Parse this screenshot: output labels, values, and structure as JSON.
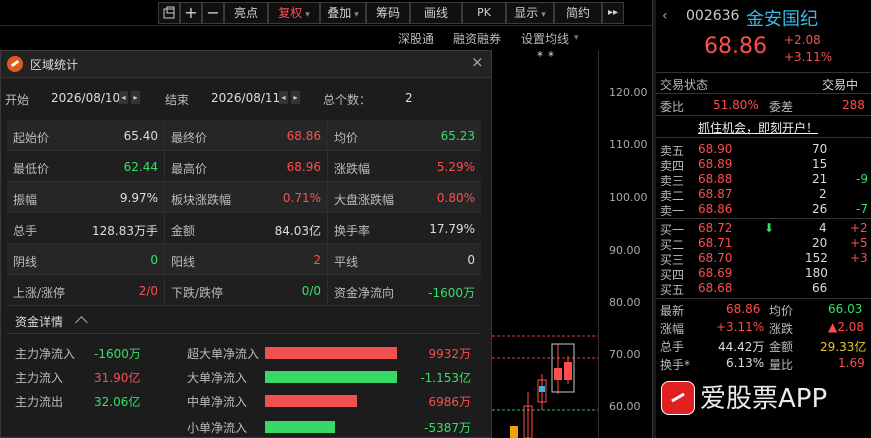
{
  "toolbar": {
    "icons": [
      "window-icon",
      "plus-icon",
      "minus-icon"
    ],
    "buttons": [
      {
        "label": "亮点",
        "active": false
      },
      {
        "label": "复权",
        "active": true,
        "caret": "▾"
      },
      {
        "label": "叠加",
        "active": false,
        "caret": "▾"
      },
      {
        "label": "筹码",
        "active": false
      },
      {
        "label": "画线",
        "active": false
      },
      {
        "label": "PK",
        "active": false
      },
      {
        "label": "显示",
        "active": false,
        "caret": "▾"
      },
      {
        "label": "简约",
        "active": false
      }
    ],
    "more": "▸▸",
    "subbar": {
      "sh_sz": "深股通",
      "margin": "融资融券",
      "ma": "设置均线",
      "ma_caret": "▾"
    }
  },
  "chart": {
    "stars": "**",
    "y_ticks": [
      "120.00",
      "110.00",
      "100.00",
      "90.00",
      "80.00",
      "70.00",
      "60.00"
    ]
  },
  "dialog": {
    "title": "区域统计",
    "close": "×",
    "start_label": "开始",
    "start_value": "2026/08/10",
    "end_label": "结束",
    "end_value": "2026/08/11",
    "count_label": "总个数：",
    "count_value": "2",
    "stats": [
      [
        {
          "l": "起始价",
          "v": "65.40",
          "c": "white"
        },
        {
          "l": "最终价",
          "v": "68.86",
          "c": "red"
        },
        {
          "l": "均价",
          "v": "65.23",
          "c": "green"
        }
      ],
      [
        {
          "l": "最低价",
          "v": "62.44",
          "c": "green"
        },
        {
          "l": "最高价",
          "v": "68.96",
          "c": "red"
        },
        {
          "l": "涨跌幅",
          "v": "5.29%",
          "c": "red"
        }
      ],
      [
        {
          "l": "振幅",
          "v": "9.97%",
          "c": "white"
        },
        {
          "l": "板块涨跌幅",
          "v": "0.71%",
          "c": "red"
        },
        {
          "l": "大盘涨跌幅",
          "v": "0.80%",
          "c": "red"
        }
      ],
      [
        {
          "l": "总手",
          "v": "128.83万手",
          "c": "white"
        },
        {
          "l": "金额",
          "v": "84.03亿",
          "c": "white"
        },
        {
          "l": "换手率",
          "v": "17.79%",
          "c": "white"
        }
      ],
      [
        {
          "l": "阴线",
          "v": "0",
          "c": "green"
        },
        {
          "l": "阳线",
          "v": "2",
          "c": "red"
        },
        {
          "l": "平线",
          "v": "0",
          "c": "white"
        }
      ],
      [
        {
          "l": "上涨/涨停",
          "v": "2/0",
          "c": "red"
        },
        {
          "l": "下跌/跌停",
          "v": "0/0",
          "c": "green"
        },
        {
          "l": "资金净流向",
          "v": "-1600万",
          "c": "green"
        }
      ]
    ],
    "detail": {
      "title": "资金详情",
      "left": [
        {
          "l": "主力净流入",
          "v": "-1600万",
          "c": "green"
        },
        {
          "l": "主力流入",
          "v": "31.90亿",
          "c": "red"
        },
        {
          "l": "主力流出",
          "v": "32.06亿",
          "c": "green"
        }
      ],
      "right": [
        {
          "l": "超大单净流入",
          "v": "9932万",
          "c": "red",
          "ratio": 1.0,
          "color": "#f05050"
        },
        {
          "l": "大单净流入",
          "v": "-1.153亿",
          "c": "green",
          "ratio": 1.0,
          "color": "#38d868"
        },
        {
          "l": "中单净流入",
          "v": "6986万",
          "c": "red",
          "ratio": 0.7,
          "color": "#f05050"
        },
        {
          "l": "小单净流入",
          "v": "-5387万",
          "c": "green",
          "ratio": 0.53,
          "color": "#38d868"
        }
      ]
    }
  },
  "quote": {
    "nav": "‹",
    "code": "002636",
    "name": "金安国纪",
    "price": "68.86",
    "change": "+2.08",
    "pct": "+3.11%",
    "status_label": "交易状态",
    "status_value": "交易中",
    "wb_label": "委比",
    "wb_value": "51.80%",
    "wc_label": "委差",
    "wc_value": "288",
    "promo": "抓住机会，即刻开户！",
    "asks": [
      {
        "l": "卖五",
        "p": "68.90",
        "v": "70",
        "d": ""
      },
      {
        "l": "卖四",
        "p": "68.89",
        "v": "15",
        "d": ""
      },
      {
        "l": "卖三",
        "p": "68.88",
        "v": "21",
        "d": "-9"
      },
      {
        "l": "卖二",
        "p": "68.87",
        "v": "2",
        "d": ""
      },
      {
        "l": "卖一",
        "p": "68.86",
        "v": "26",
        "d": "-7"
      }
    ],
    "bids": [
      {
        "l": "买一",
        "p": "68.72",
        "v": "4",
        "d": "+2",
        "arrow": "⬇"
      },
      {
        "l": "买二",
        "p": "68.71",
        "v": "20",
        "d": "+5"
      },
      {
        "l": "买三",
        "p": "68.70",
        "v": "152",
        "d": "+3"
      },
      {
        "l": "买四",
        "p": "68.69",
        "v": "180",
        "d": ""
      },
      {
        "l": "买五",
        "p": "68.68",
        "v": "66",
        "d": ""
      }
    ],
    "latest_label": "最新",
    "latest_value": "68.86",
    "avg_label": "均价",
    "avg_value": "66.03",
    "zf_label": "涨幅",
    "zf_value": "+3.11%",
    "zd_label": "涨跌",
    "zd_value": "▲2.08",
    "zs_label": "总手",
    "zs_value": "44.42万",
    "je_label": "金额",
    "je_value": "29.33亿",
    "hs_label": "换手*",
    "hs_value": "6.13%",
    "lb_label": "量比",
    "lb_value": "1.69"
  },
  "watermark": {
    "text": "爱股票APP"
  }
}
